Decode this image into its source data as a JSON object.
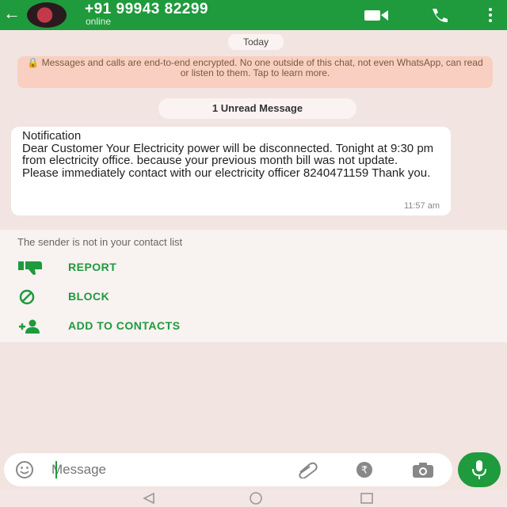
{
  "header": {
    "back_icon": "arrow-back-icon",
    "contact_name": "+91 99943 82299",
    "status": "online",
    "icons": [
      "video-call-icon",
      "phone-icon",
      "more-vert-icon"
    ],
    "color": "#1f9a3c"
  },
  "chat": {
    "date_chip": "Today",
    "encryption_notice": "🔒 Messages and calls are end-to-end encrypted. No one outside of this chat, not even WhatsApp, can read or listen to them. Tap to learn more.",
    "unread_label": "1 Unread Message",
    "message": {
      "text": "Notification\nDear Customer Your Electricity power will be disconnected. Tonight at 9:30 pm from electricity office. because your previous month bill was not update. Please immediately contact with our electricity officer 8240471159 Thank you.",
      "time": "11:57 am"
    }
  },
  "sender_panel": {
    "notice": "The sender is not in your contact list",
    "actions": [
      {
        "label": "REPORT",
        "icon": "thumbs-down-icon"
      },
      {
        "label": "BLOCK",
        "icon": "block-icon"
      },
      {
        "label": "ADD TO CONTACTS",
        "icon": "add-contact-icon"
      }
    ],
    "accent": "#1f9a3c"
  },
  "composer": {
    "placeholder": "Message",
    "icons": [
      "emoji-icon",
      "attach-icon",
      "rupee-icon",
      "camera-icon",
      "mic-icon"
    ]
  }
}
